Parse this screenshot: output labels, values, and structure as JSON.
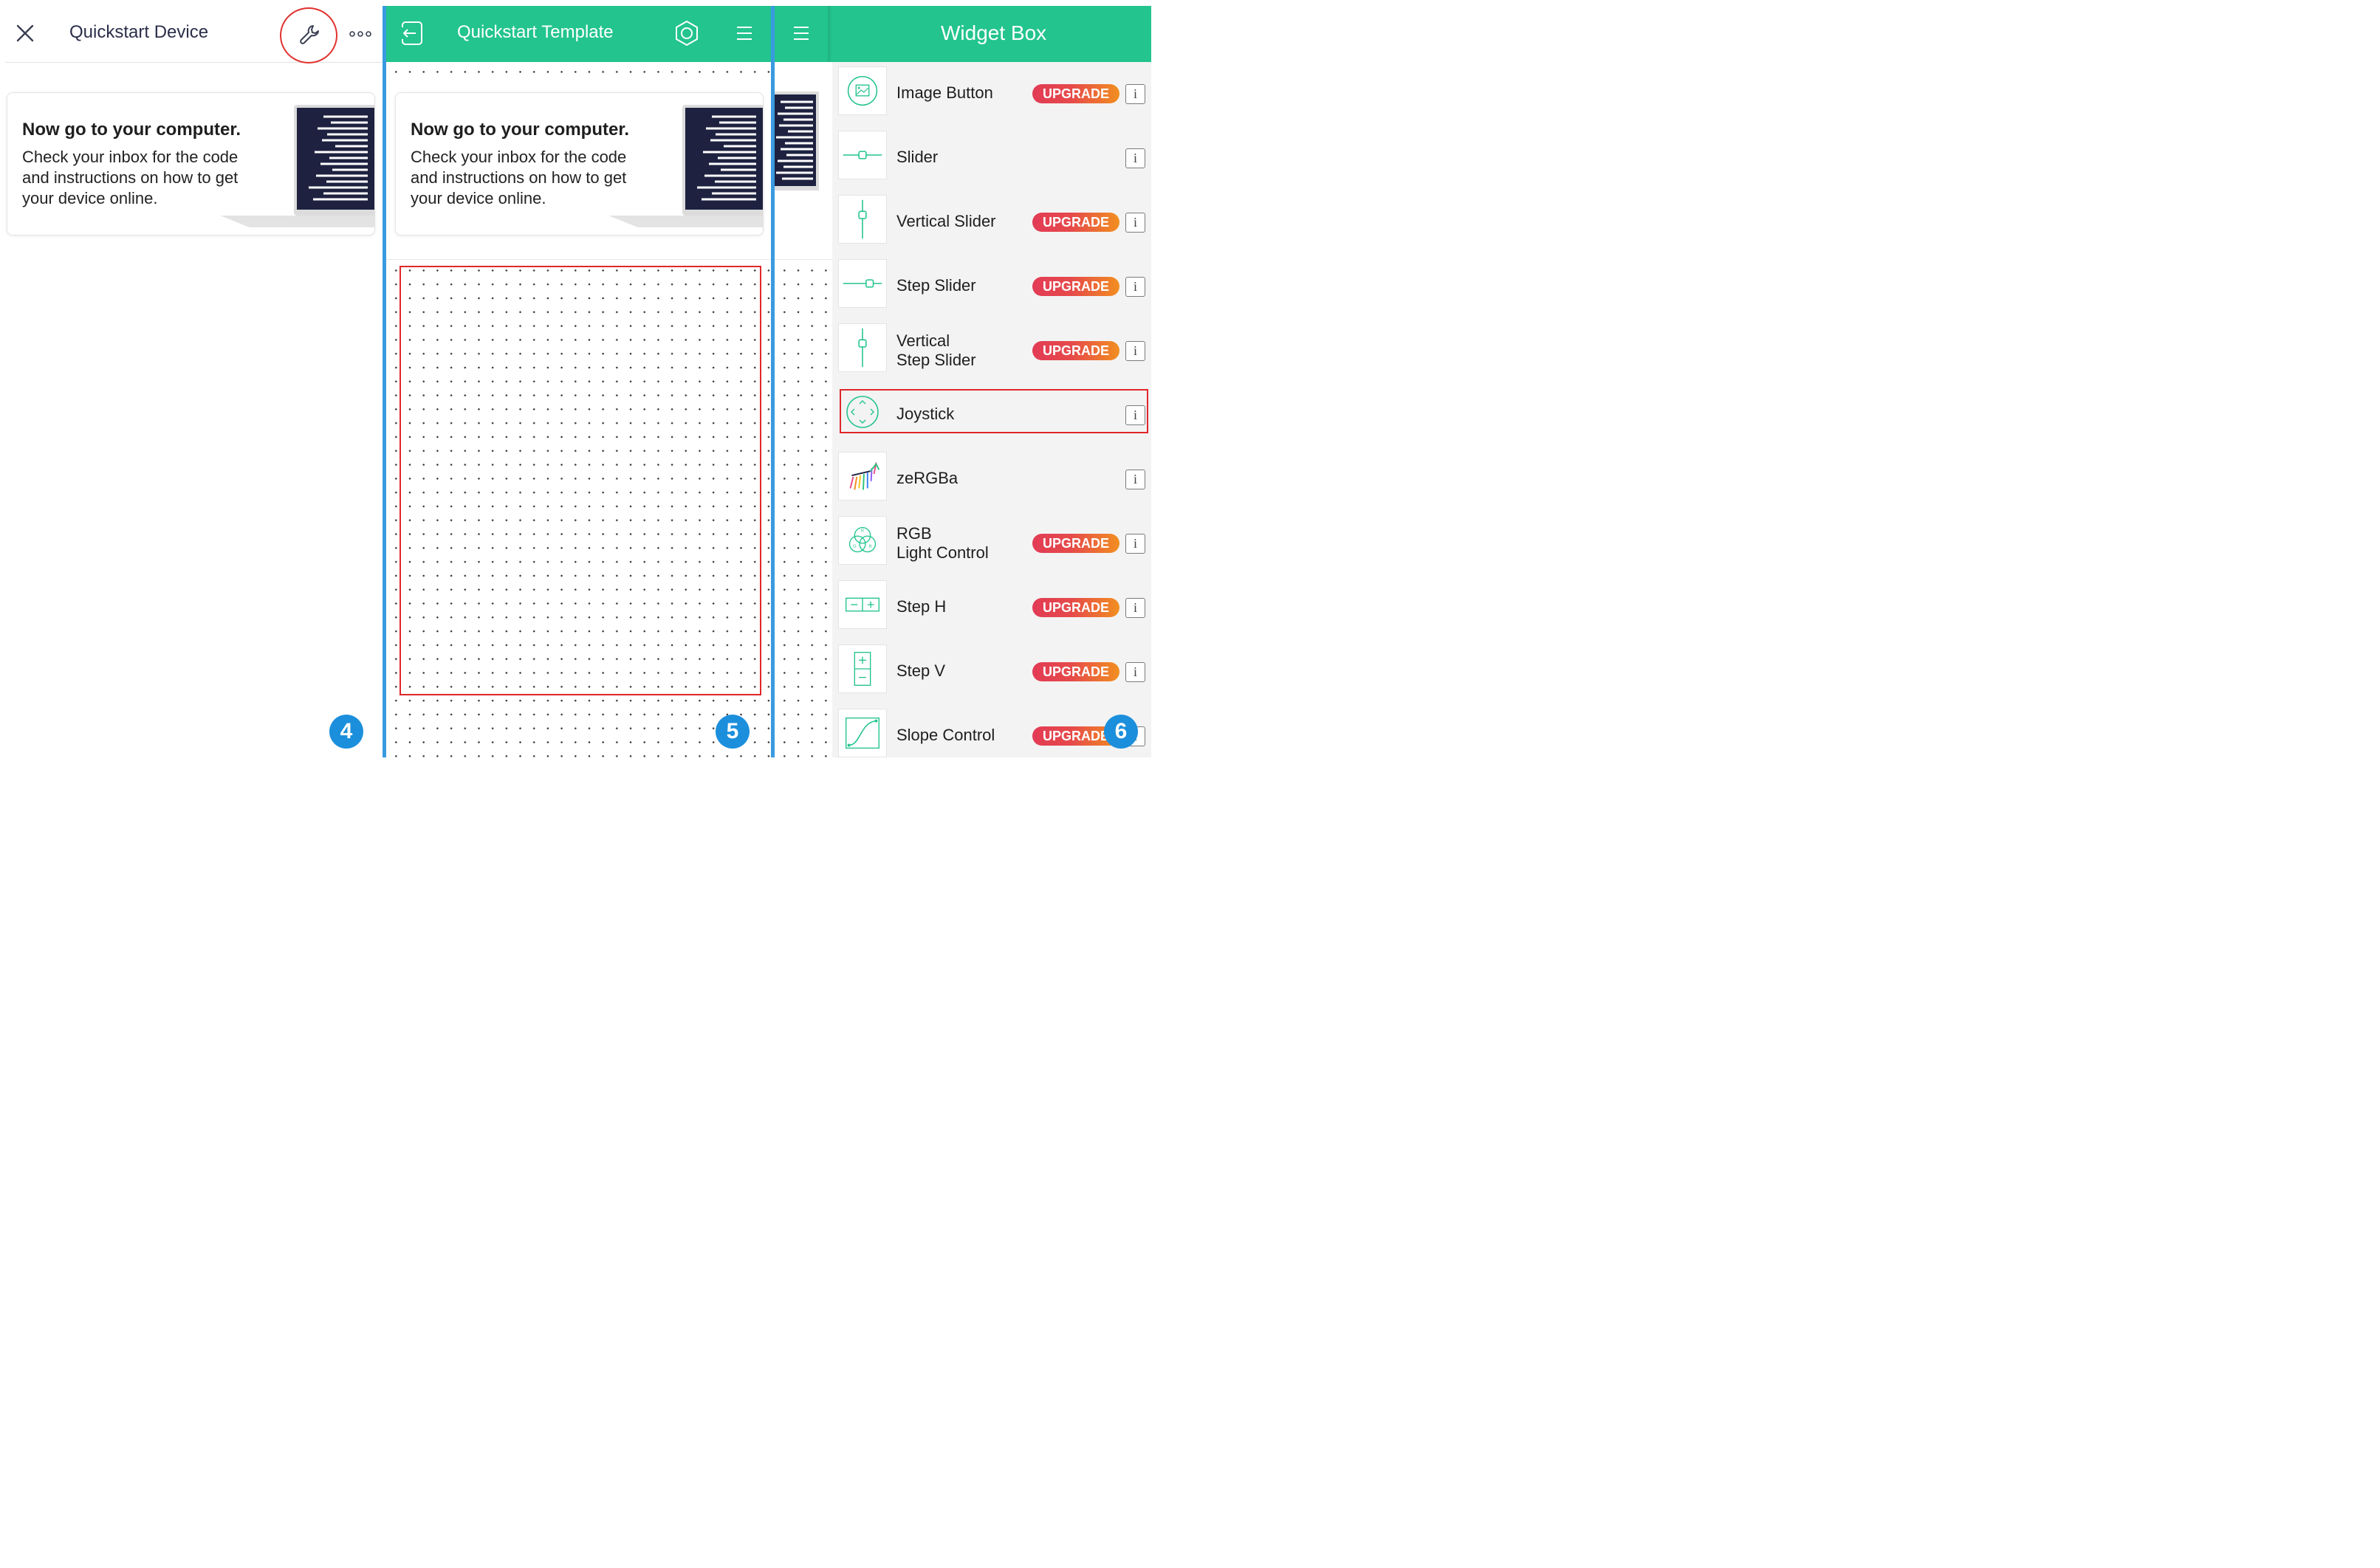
{
  "panel4": {
    "title": "Quickstart Device",
    "card_title": "Now go to your computer.",
    "card_body": "Check your inbox for the code and instructions on how to get your device online.",
    "step": "4"
  },
  "panel5": {
    "title": "Quickstart Template",
    "card_title": "Now go to your computer.",
    "card_body": "Check your inbox for the code and instructions on how to get your device online.",
    "step": "5"
  },
  "panel6": {
    "title": "Widget Box",
    "step": "6",
    "upgrade_label": "UPGRADE",
    "info_label": "i",
    "items": [
      {
        "label": "Image Button",
        "upgrade": true
      },
      {
        "label": "Slider",
        "upgrade": false
      },
      {
        "label": "Vertical Slider",
        "upgrade": true
      },
      {
        "label": "Step Slider",
        "upgrade": true
      },
      {
        "label": "Vertical\nStep Slider",
        "upgrade": true
      },
      {
        "label": "Joystick",
        "upgrade": false
      },
      {
        "label": "zeRGBa",
        "upgrade": false
      },
      {
        "label": "RGB\nLight Control",
        "upgrade": true
      },
      {
        "label": "Step H",
        "upgrade": true
      },
      {
        "label": "Step V",
        "upgrade": true
      },
      {
        "label": "Slope Control",
        "upgrade": true
      }
    ]
  },
  "colors": {
    "accent_green": "#23c48e",
    "highlight_red": "#e0262a",
    "divider_blue": "#3a9ae0",
    "badge_blue": "#1b8fdc"
  }
}
